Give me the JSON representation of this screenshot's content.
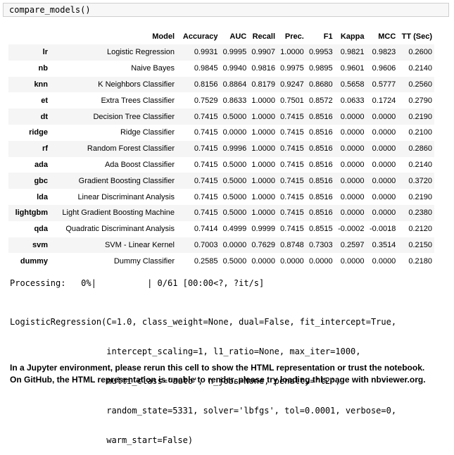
{
  "cell": {
    "code": "compare_models()"
  },
  "table": {
    "columns": [
      "",
      "Model",
      "Accuracy",
      "AUC",
      "Recall",
      "Prec.",
      "F1",
      "Kappa",
      "MCC",
      "TT (Sec)"
    ],
    "rows": [
      [
        "lr",
        "Logistic Regression",
        "0.9931",
        "0.9995",
        "0.9907",
        "1.0000",
        "0.9953",
        "0.9821",
        "0.9823",
        "0.2600"
      ],
      [
        "nb",
        "Naive Bayes",
        "0.9845",
        "0.9940",
        "0.9816",
        "0.9975",
        "0.9895",
        "0.9601",
        "0.9606",
        "0.2140"
      ],
      [
        "knn",
        "K Neighbors Classifier",
        "0.8156",
        "0.8864",
        "0.8179",
        "0.9247",
        "0.8680",
        "0.5658",
        "0.5777",
        "0.2560"
      ],
      [
        "et",
        "Extra Trees Classifier",
        "0.7529",
        "0.8633",
        "1.0000",
        "0.7501",
        "0.8572",
        "0.0633",
        "0.1724",
        "0.2790"
      ],
      [
        "dt",
        "Decision Tree Classifier",
        "0.7415",
        "0.5000",
        "1.0000",
        "0.7415",
        "0.8516",
        "0.0000",
        "0.0000",
        "0.2190"
      ],
      [
        "ridge",
        "Ridge Classifier",
        "0.7415",
        "0.0000",
        "1.0000",
        "0.7415",
        "0.8516",
        "0.0000",
        "0.0000",
        "0.2100"
      ],
      [
        "rf",
        "Random Forest Classifier",
        "0.7415",
        "0.9996",
        "1.0000",
        "0.7415",
        "0.8516",
        "0.0000",
        "0.0000",
        "0.2860"
      ],
      [
        "ada",
        "Ada Boost Classifier",
        "0.7415",
        "0.5000",
        "1.0000",
        "0.7415",
        "0.8516",
        "0.0000",
        "0.0000",
        "0.2140"
      ],
      [
        "gbc",
        "Gradient Boosting Classifier",
        "0.7415",
        "0.5000",
        "1.0000",
        "0.7415",
        "0.8516",
        "0.0000",
        "0.0000",
        "0.3720"
      ],
      [
        "lda",
        "Linear Discriminant Analysis",
        "0.7415",
        "0.5000",
        "1.0000",
        "0.7415",
        "0.8516",
        "0.0000",
        "0.0000",
        "0.2190"
      ],
      [
        "lightgbm",
        "Light Gradient Boosting Machine",
        "0.7415",
        "0.5000",
        "1.0000",
        "0.7415",
        "0.8516",
        "0.0000",
        "0.0000",
        "0.2380"
      ],
      [
        "qda",
        "Quadratic Discriminant Analysis",
        "0.7414",
        "0.4999",
        "0.9999",
        "0.7415",
        "0.8515",
        "-0.0002",
        "-0.0018",
        "0.2120"
      ],
      [
        "svm",
        "SVM - Linear Kernel",
        "0.7003",
        "0.0000",
        "0.7629",
        "0.8748",
        "0.7303",
        "0.2597",
        "0.3514",
        "0.2150"
      ],
      [
        "dummy",
        "Dummy Classifier",
        "0.2585",
        "0.5000",
        "0.0000",
        "0.0000",
        "0.0000",
        "0.0000",
        "0.0000",
        "0.2180"
      ]
    ]
  },
  "processing": "Processing:   0%|          | 0/61 [00:00<?, ?it/s]",
  "repr_lines": [
    "LogisticRegression(C=1.0, class_weight=None, dual=False, fit_intercept=True,",
    "                   intercept_scaling=1, l1_ratio=None, max_iter=1000,",
    "                   multi_class='auto', n_jobs=None, penalty='l2',",
    "                   random_state=5331, solver='lbfgs', tol=0.0001, verbose=0,",
    "                   warm_start=False)"
  ],
  "notice": [
    "In a Jupyter environment, please rerun this cell to show the HTML representation or trust the notebook.",
    "On GitHub, the HTML representation is unable to render, please try loading this page with nbviewer.org."
  ]
}
